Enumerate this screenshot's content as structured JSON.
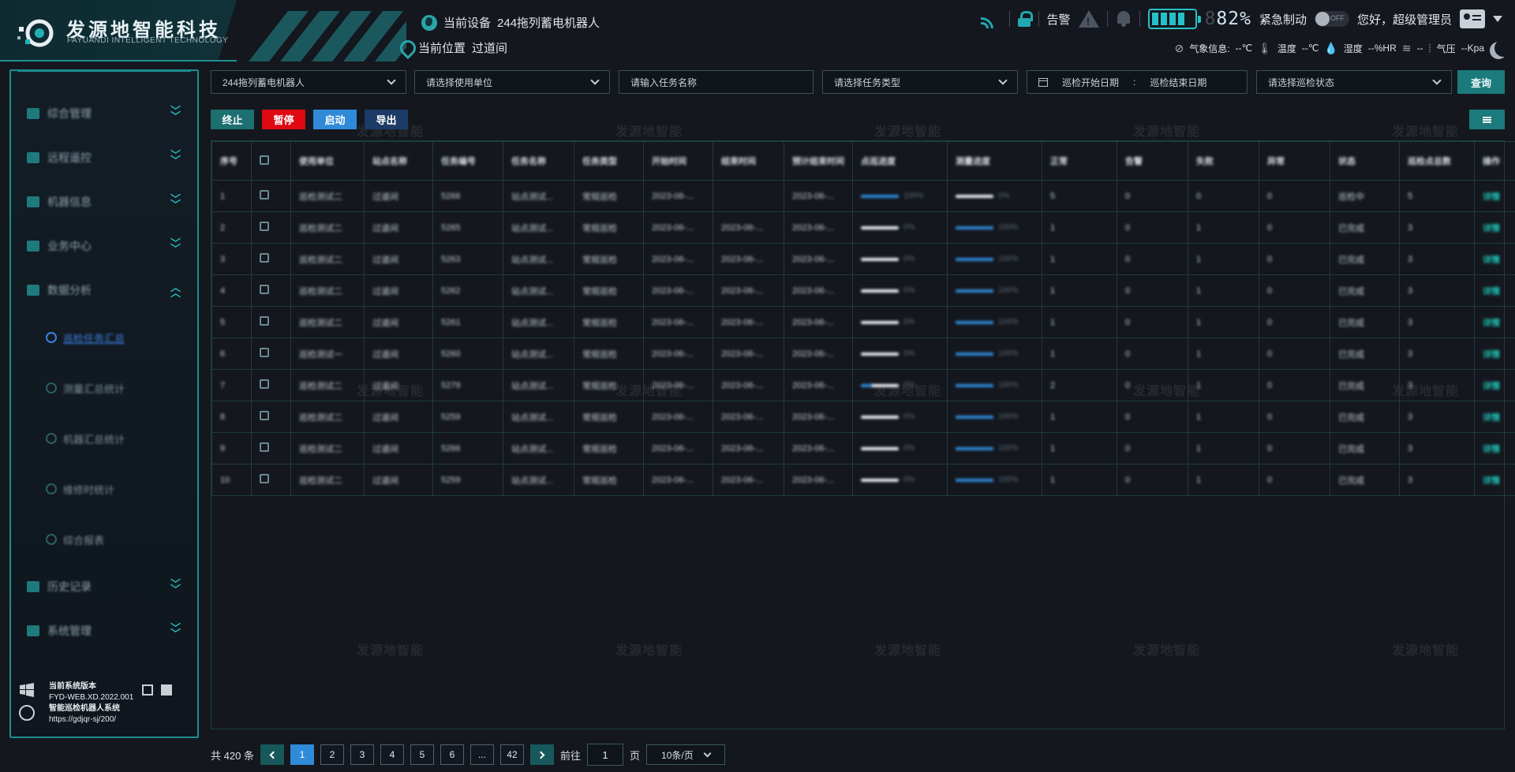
{
  "brand": {
    "name_cn": "发源地智能科技",
    "name_en": "FAYUANDI INTELLIGENT TECHNOLOGY"
  },
  "watermark": "发源地智能",
  "header": {
    "device_label": "当前设备",
    "device_value": "244拖列蓄电机器人",
    "location_label": "当前位置",
    "location_value": "过道间",
    "alarm_label": "告警",
    "battery_dim_digit": "8",
    "battery_value": "82%",
    "battery_level": 0.82,
    "estop_label": "紧急制动",
    "estop_state": "OFF",
    "greeting": "您好，超级管理员",
    "weather": {
      "label": "气象信息:",
      "temp_label": "温度",
      "temp_value": "--℃",
      "humidity_label": "湿度",
      "humidity_value": "--%HR",
      "wind_value": "--",
      "pressure_label": "气压",
      "pressure_value": "--Kpa"
    },
    "icons": [
      "signal-icon",
      "lock-icon",
      "warning-icon",
      "bell-icon",
      "battery-icon",
      "user-icon",
      "moon-icon"
    ]
  },
  "sidebar": {
    "items": [
      {
        "label": "综合管理"
      },
      {
        "label": "远程遥控"
      },
      {
        "label": "机器信息"
      },
      {
        "label": "业务中心"
      },
      {
        "label": "数据分析",
        "expanded": true
      }
    ],
    "subitems": [
      {
        "label": "巡检任务汇总",
        "active": true
      },
      {
        "label": "测量汇总统计"
      },
      {
        "label": "机器汇总统计"
      },
      {
        "label": "维修时统计"
      },
      {
        "label": "综合报表"
      }
    ],
    "items_after": [
      {
        "label": "历史记录"
      },
      {
        "label": "系统管理"
      }
    ],
    "footer": {
      "version_label": "当前系统版本",
      "version_value": "FYD-WEB.XD.2022.001",
      "system_name": "智能巡检机器人系统",
      "url": "https://gdjqr-sj/200/"
    }
  },
  "filters": {
    "robot": "244拖列蓄电机器人",
    "unit_placeholder": "请选择使用单位",
    "task_name_placeholder": "请输入任务名称",
    "task_type_placeholder": "请选择任务类型",
    "start_date_placeholder": "巡检开始日期",
    "date_separator": ":",
    "end_date_placeholder": "巡检结束日期",
    "status_placeholder": "请选择巡检状态",
    "query_label": "查询"
  },
  "actions": {
    "stop": "终止",
    "pause": "暂停",
    "start": "启动",
    "export": "导出"
  },
  "table": {
    "headers": [
      "序号",
      "",
      "使用单位",
      "站点名称",
      "任务编号",
      "任务名称",
      "任务类型",
      "开始时间",
      "结束时间",
      "预计结束时间",
      "点巡进度",
      "测量进度",
      "正常",
      "告警",
      "失败",
      "异常",
      "状态",
      "巡检点总数",
      "操作"
    ],
    "rows": [
      {
        "no": "1",
        "unit": "巡检测试二",
        "site": "过道间",
        "code": "5266",
        "name": "站点测试...",
        "type": "常规巡检",
        "start": "2023-06-...",
        "end": "",
        "eta": "2023-06-...",
        "p1": "100%",
        "p1v": 1,
        "p2": "0%",
        "p2v": 0,
        "ok": "5",
        "alarm": "0",
        "fail": "0",
        "abn": "0",
        "status": "巡检中",
        "total": "5",
        "op": "详情"
      },
      {
        "no": "2",
        "unit": "巡检测试二",
        "site": "过道间",
        "code": "5265",
        "name": "站点测试...",
        "type": "常规巡检",
        "start": "2023-06-...",
        "end": "2023-06-...",
        "eta": "2023-06-...",
        "p1": "0%",
        "p1v": 0,
        "p2": "100%",
        "p2v": 1,
        "ok": "1",
        "alarm": "0",
        "fail": "1",
        "abn": "0",
        "status": "已完成",
        "total": "3",
        "op": "详情"
      },
      {
        "no": "3",
        "unit": "巡检测试二",
        "site": "过道间",
        "code": "5263",
        "name": "站点测试...",
        "type": "常规巡检",
        "start": "2023-06-...",
        "end": "2023-06-...",
        "eta": "2023-06-...",
        "p1": "0%",
        "p1v": 0,
        "p2": "100%",
        "p2v": 1,
        "ok": "1",
        "alarm": "0",
        "fail": "1",
        "abn": "0",
        "status": "已完成",
        "total": "3",
        "op": "详情"
      },
      {
        "no": "4",
        "unit": "巡检测试二",
        "site": "过道间",
        "code": "5262",
        "name": "站点测试...",
        "type": "常规巡检",
        "start": "2023-06-...",
        "end": "2023-06-...",
        "eta": "2023-06-...",
        "p1": "0%",
        "p1v": 0,
        "p2": "100%",
        "p2v": 1,
        "ok": "1",
        "alarm": "0",
        "fail": "1",
        "abn": "0",
        "status": "已完成",
        "total": "3",
        "op": "详情"
      },
      {
        "no": "5",
        "unit": "巡检测试二",
        "site": "过道间",
        "code": "5261",
        "name": "站点测试...",
        "type": "常规巡检",
        "start": "2023-06-...",
        "end": "2023-06-...",
        "eta": "2023-06-...",
        "p1": "0%",
        "p1v": 0,
        "p2": "100%",
        "p2v": 1,
        "ok": "1",
        "alarm": "0",
        "fail": "1",
        "abn": "0",
        "status": "已完成",
        "total": "3",
        "op": "详情"
      },
      {
        "no": "6",
        "unit": "巡检测试一",
        "site": "过道间",
        "code": "5260",
        "name": "站点测试...",
        "type": "常规巡检",
        "start": "2023-06-...",
        "end": "2023-06-...",
        "eta": "2023-06-...",
        "p1": "0%",
        "p1v": 0,
        "p2": "100%",
        "p2v": 1,
        "ok": "1",
        "alarm": "0",
        "fail": "1",
        "abn": "0",
        "status": "已完成",
        "total": "3",
        "op": "详情"
      },
      {
        "no": "7",
        "unit": "巡检测试二",
        "site": "过道间",
        "code": "5279",
        "name": "站点测试...",
        "type": "常规巡检",
        "start": "2023-06-...",
        "end": "2023-06-...",
        "eta": "2023-06-...",
        "p1": "0%",
        "p1v": 0.3,
        "p2": "100%",
        "p2v": 1,
        "ok": "2",
        "alarm": "0",
        "fail": "1",
        "abn": "0",
        "status": "已完成",
        "total": "3",
        "op": "详情"
      },
      {
        "no": "8",
        "unit": "巡检测试二",
        "site": "过道间",
        "code": "5259",
        "name": "站点测试...",
        "type": "常规巡检",
        "start": "2023-06-...",
        "end": "2023-06-...",
        "eta": "2023-06-...",
        "p1": "0%",
        "p1v": 0,
        "p2": "100%",
        "p2v": 1,
        "ok": "1",
        "alarm": "0",
        "fail": "1",
        "abn": "0",
        "status": "已完成",
        "total": "3",
        "op": "详情"
      },
      {
        "no": "9",
        "unit": "巡检测试二",
        "site": "过道间",
        "code": "5266",
        "name": "站点测试...",
        "type": "常规巡检",
        "start": "2023-06-...",
        "end": "2023-06-...",
        "eta": "2023-06-...",
        "p1": "0%",
        "p1v": 0,
        "p2": "100%",
        "p2v": 1,
        "ok": "1",
        "alarm": "0",
        "fail": "1",
        "abn": "0",
        "status": "已完成",
        "total": "3",
        "op": "详情"
      },
      {
        "no": "10",
        "unit": "巡检测试二",
        "site": "过道间",
        "code": "5259",
        "name": "站点测试...",
        "type": "常规巡检",
        "start": "2023-06-...",
        "end": "2023-06-...",
        "eta": "2023-06-...",
        "p1": "0%",
        "p1v": 0,
        "p2": "100%",
        "p2v": 1,
        "ok": "1",
        "alarm": "0",
        "fail": "1",
        "abn": "0",
        "status": "已完成",
        "total": "3",
        "op": "详情"
      }
    ]
  },
  "pagination": {
    "total_prefix": "共",
    "total": "420",
    "total_suffix": "条",
    "pages": [
      "1",
      "2",
      "3",
      "4",
      "5",
      "6",
      "...",
      "42"
    ],
    "current": "1",
    "goto_label": "前往",
    "goto_value": "1",
    "page_suffix": "页",
    "page_size": "10条/页"
  },
  "colors": {
    "accent": "#1b8e8e",
    "primary_blue": "#2f8ad8",
    "danger": "#e00811",
    "background": "#14171e"
  }
}
